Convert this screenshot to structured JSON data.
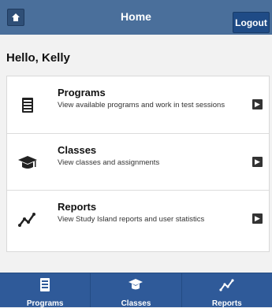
{
  "header": {
    "title": "Home",
    "logout_label": "Logout"
  },
  "greeting": "Hello, Kelly",
  "menu": [
    {
      "title": "Programs",
      "description": "View available programs and work in test sessions",
      "icon": "programs-icon"
    },
    {
      "title": "Classes",
      "description": "View classes and assignments",
      "icon": "classes-icon"
    },
    {
      "title": "Reports",
      "description": "View Study Island reports and user statistics",
      "icon": "reports-icon"
    }
  ],
  "bottom_nav": [
    {
      "label": "Programs",
      "icon": "programs-icon"
    },
    {
      "label": "Classes",
      "icon": "classes-icon"
    },
    {
      "label": "Reports",
      "icon": "reports-icon"
    }
  ],
  "colors": {
    "header": "#4a6f9b",
    "nav": "#2f5a99",
    "logout": "#1f4b86"
  }
}
